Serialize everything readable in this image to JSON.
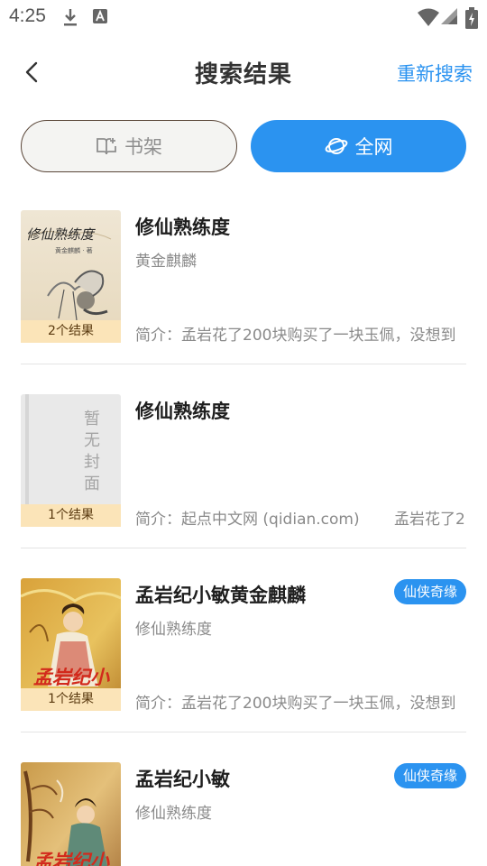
{
  "status_bar": {
    "time": "4:25"
  },
  "header": {
    "title": "搜索结果",
    "research_label": "重新搜索"
  },
  "scope": {
    "shelf_label": "书架",
    "web_label": "全网",
    "active": "全网"
  },
  "colors": {
    "accent": "#2b93f0",
    "badge_bg": "#fbe4b8"
  },
  "results": [
    {
      "title": "修仙熟练度",
      "author": "黄金麒麟",
      "count": "2个结果",
      "intro": "简介：孟岩花了200块购买了一块玉佩，没想到",
      "cover_title": "修仙熟练度",
      "cover_caption": "黄金麒麟 · 著"
    },
    {
      "title": "修仙熟练度",
      "author": "",
      "count": "1个结果",
      "intro": "简介：起点中文网 (qidian.com)",
      "intro_extra": "孟岩花了2",
      "placeholder": "暂无封面"
    },
    {
      "title": "孟岩纪小敏黄金麒麟",
      "author": "修仙熟练度",
      "tag": "仙侠奇缘",
      "count": "1个结果",
      "intro": "简介：孟岩花了200块购买了一块玉佩，没想到",
      "cover_title": "孟岩纪小"
    },
    {
      "title": "孟岩纪小敏",
      "author": "修仙熟练度",
      "tag": "仙侠奇缘",
      "cover_title": "孟岩纪小"
    }
  ]
}
